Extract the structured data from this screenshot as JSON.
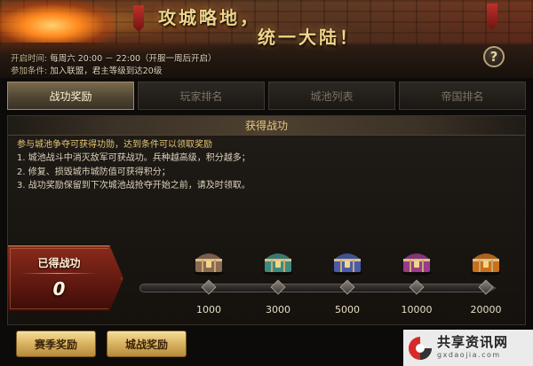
{
  "banner": {
    "title_part1": "攻城略地，",
    "title_part2": "统一大陆！",
    "open_time_label": "开启时间:",
    "open_time_value": "每周六 20:00 － 22:00（开服一周后开启）",
    "condition_label": "参加条件:",
    "condition_value": "加入联盟，君主等级到达20级",
    "help_icon": "question-mark-icon",
    "help_symbol": "?"
  },
  "tabs": [
    {
      "label": "战功奖励",
      "active": true
    },
    {
      "label": "玩家排名",
      "active": false
    },
    {
      "label": "城池列表",
      "active": false
    },
    {
      "label": "帝国排名",
      "active": false
    }
  ],
  "panel": {
    "header": "获得战功",
    "intro": "参与城池争夺可获得功勋，达到条件可以领取奖励",
    "rules": [
      "1. 城池战斗中消灭敌军可获战功。兵种越高级，积分越多；",
      "2. 修复、损毁城市城防值可获得积分；",
      "3. 战功奖励保留到下次城池战抢夺开始之前，请及时领取。"
    ]
  },
  "achieved": {
    "label": "已得战功",
    "value": "0"
  },
  "milestones": [
    {
      "value": "1000",
      "chest_icon": "bronze-chest-icon",
      "color": "#8a6a52"
    },
    {
      "value": "3000",
      "chest_icon": "teal-chest-icon",
      "color": "#3f8a80"
    },
    {
      "value": "5000",
      "chest_icon": "blue-chest-icon",
      "color": "#4a5ca8"
    },
    {
      "value": "10000",
      "chest_icon": "purple-chest-icon",
      "color": "#9a3a8a"
    },
    {
      "value": "20000",
      "chest_icon": "gold-chest-icon",
      "color": "#c8701a"
    }
  ],
  "buttons": {
    "season_reward": "赛季奖励",
    "city_war_reward": "城战奖励"
  },
  "watermark": {
    "text": "共享资讯网",
    "url": "gxdaojia.com"
  }
}
